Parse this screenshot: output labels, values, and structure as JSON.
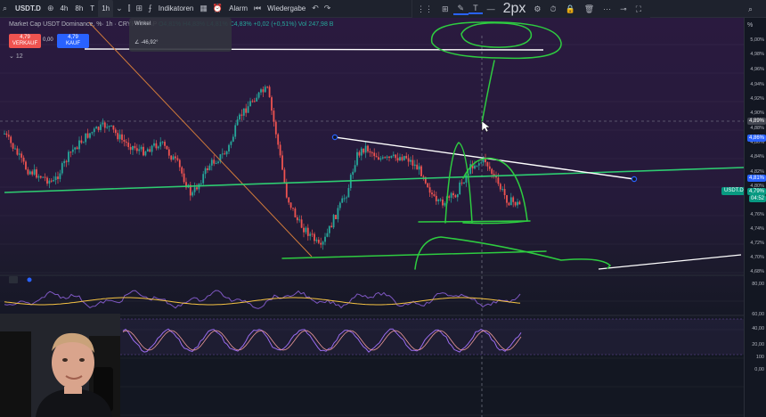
{
  "toolbar": {
    "symbol": "USDT.D",
    "intervals": [
      "4h",
      "8h",
      "T",
      "1h"
    ],
    "indicators_label": "Indikatoren",
    "alarm_label": "Alarm",
    "replay_label": "Wiedergabe",
    "stroke_width": "2px"
  },
  "legend": {
    "title": "Market Cap USDT Dominance, %· 1h · CRYPTOCAP",
    "ohlc": "O4,81% H4,83% L4,81% C4,83% +0,02 (+0,51%) Vol 247,98 B",
    "sell_price": "4,79",
    "sell_label": "VERKAUF",
    "spread": "0,00",
    "buy_price": "4,79",
    "buy_label": "KAUF",
    "interval_count": "12"
  },
  "tooltip": {
    "line1": "Winkel",
    "angle": "-46,92°"
  },
  "price_scale": {
    "labels": [
      "5,00%",
      "4,98%",
      "4,96%",
      "4,94%",
      "4,92%",
      "4,90%",
      "4,88%",
      "4,86%",
      "4,84%",
      "4,82%",
      "4,80%",
      "4,78%",
      "4,76%",
      "4,74%",
      "4,72%",
      "4,70%",
      "4,68%",
      "80,00",
      "60,00",
      "40,00",
      "20,00",
      "100",
      "0,00"
    ],
    "crosshair_price": "4,89%",
    "line_price_1": "4,86%",
    "line_price_2": "4,81%",
    "current_price": "4,79%",
    "countdown": "04:52",
    "symbol_tag": "USDT.D",
    "percent_label": "%"
  },
  "colors": {
    "up": "#26a69a",
    "down": "#ef5350",
    "trendline_white": "#ffffff",
    "trendline_green": "#22c55e",
    "trendline_orange": "#d07a3a",
    "drawing": "#2ecc40",
    "rsi": "#7e57c2",
    "rsi_ma": "#f6c343",
    "stoch": "#7e57c2"
  },
  "icons": {
    "add": "plus-circle-icon",
    "compare": "compare-icon",
    "indicators": "indicators-icon",
    "layout": "layout-grid-icon",
    "alarm": "alarm-clock-icon",
    "replay": "replay-icon",
    "undo": "undo-icon",
    "redo": "redo-icon"
  }
}
